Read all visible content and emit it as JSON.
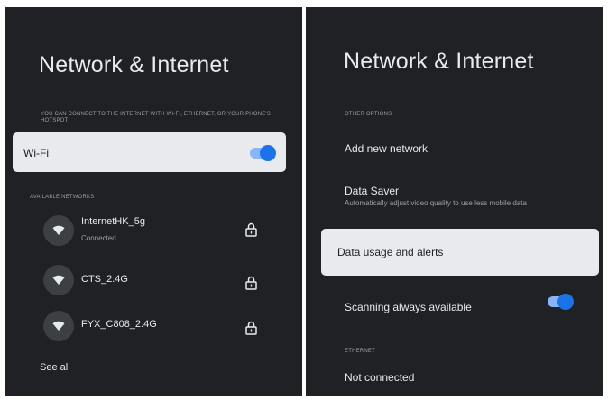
{
  "left": {
    "title": "Network & Internet",
    "description": "YOU CAN CONNECT TO THE INTERNET WITH WI-FI, ETHERNET, OR YOUR PHONE'S HOTSPOT",
    "wifi": {
      "label": "Wi-Fi",
      "enabled": true
    },
    "available_label": "AVAILABLE NETWORKS",
    "networks": [
      {
        "name": "InternetHK_5g",
        "status": "Connected",
        "icon": "wifi-icon",
        "secured": true
      },
      {
        "name": "CTS_2.4G",
        "status": "",
        "icon": "wifi-icon",
        "secured": true
      },
      {
        "name": "FYX_C808_2.4G",
        "status": "",
        "icon": "wifi-icon",
        "secured": true
      }
    ],
    "see_all": "See all"
  },
  "right": {
    "title": "Network & Internet",
    "other_options_label": "OTHER OPTIONS",
    "add_network": "Add new network",
    "data_saver": {
      "label": "Data Saver",
      "subtitle": "Automatically adjust video quality to use less mobile data"
    },
    "data_usage": "Data usage and alerts",
    "scanning": {
      "label": "Scanning always available",
      "enabled": true
    },
    "ethernet_label": "ETHERNET",
    "ethernet_status": "Not connected"
  },
  "colors": {
    "background": "#202124",
    "card": "#e8eaed",
    "toggle_track": "#8ab4f8",
    "toggle_knob": "#1a73e8"
  }
}
